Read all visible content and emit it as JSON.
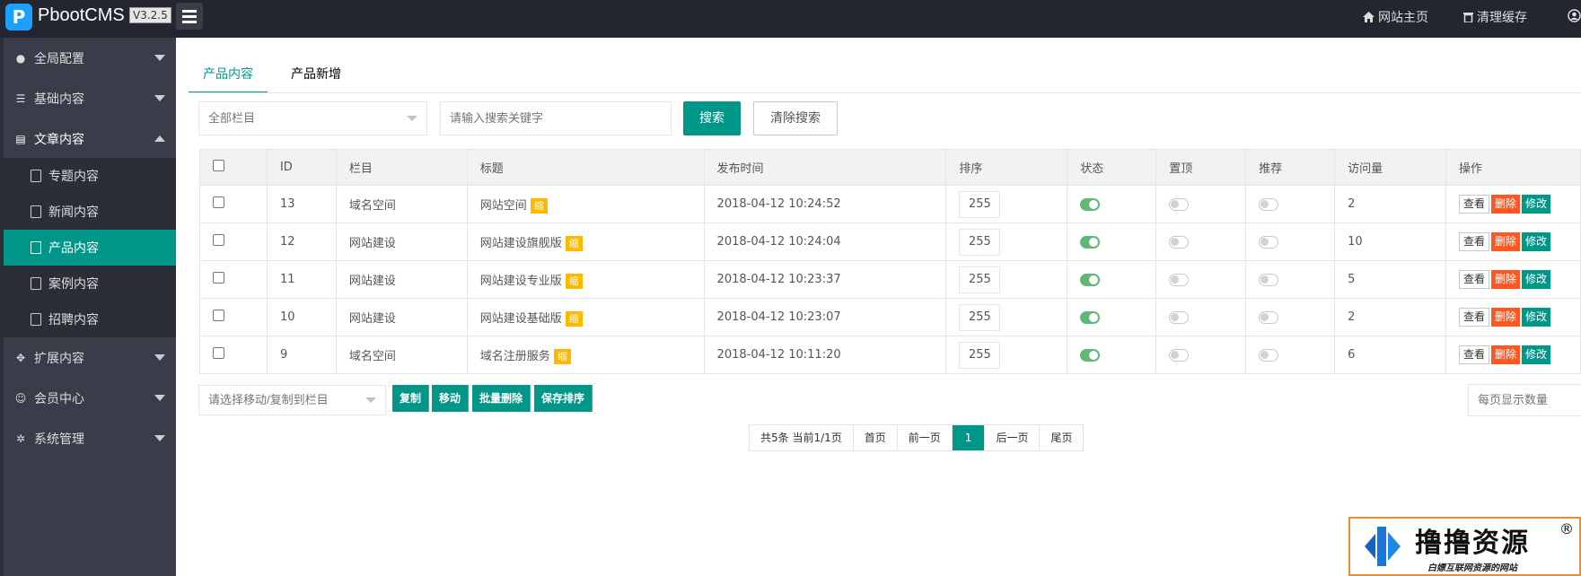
{
  "header": {
    "brand": "PbootCMS",
    "version": "V3.2.5",
    "links": [
      {
        "label": "网站主页",
        "icon": "home-icon"
      },
      {
        "label": "清理缓存",
        "icon": "trash-icon"
      }
    ]
  },
  "sidebar": {
    "groups": [
      {
        "label": "全局配置",
        "icon": "globe-icon"
      },
      {
        "label": "基础内容",
        "icon": "sliders-icon"
      },
      {
        "label": "文章内容",
        "icon": "document-icon",
        "expanded": true
      },
      {
        "label": "扩展内容",
        "icon": "expand-icon"
      },
      {
        "label": "会员中心",
        "icon": "user-icon"
      },
      {
        "label": "系统管理",
        "icon": "gear-icon"
      }
    ],
    "sub_items": [
      {
        "label": "专题内容"
      },
      {
        "label": "新闻内容"
      },
      {
        "label": "产品内容",
        "active": true
      },
      {
        "label": "案例内容"
      },
      {
        "label": "招聘内容"
      }
    ]
  },
  "tabs": [
    {
      "label": "产品内容",
      "active": true
    },
    {
      "label": "产品新增"
    }
  ],
  "filter": {
    "category_select": "全部栏目",
    "search_placeholder": "请输入搜索关键字",
    "search_button": "搜索",
    "clear_button": "清除搜索"
  },
  "table": {
    "columns": [
      "ID",
      "栏目",
      "标题",
      "发布时间",
      "排序",
      "状态",
      "置顶",
      "推荐",
      "访问量",
      "操作"
    ],
    "badge_label": "缩",
    "action_labels": {
      "view": "查看",
      "delete": "删除",
      "edit": "修改"
    },
    "rows": [
      {
        "id": "13",
        "category": "域名空间",
        "title": "网站空间",
        "date": "2018-04-12 10:24:52",
        "sort": "255",
        "status": true,
        "top": false,
        "recommend": false,
        "views": "2"
      },
      {
        "id": "12",
        "category": "网站建设",
        "title": "网站建设旗舰版",
        "date": "2018-04-12 10:24:04",
        "sort": "255",
        "status": true,
        "top": false,
        "recommend": false,
        "views": "10"
      },
      {
        "id": "11",
        "category": "网站建设",
        "title": "网站建设专业版",
        "date": "2018-04-12 10:23:37",
        "sort": "255",
        "status": true,
        "top": false,
        "recommend": false,
        "views": "5"
      },
      {
        "id": "10",
        "category": "网站建设",
        "title": "网站建设基础版",
        "date": "2018-04-12 10:23:07",
        "sort": "255",
        "status": true,
        "top": false,
        "recommend": false,
        "views": "2"
      },
      {
        "id": "9",
        "category": "域名空间",
        "title": "域名注册服务",
        "date": "2018-04-12 10:11:20",
        "sort": "255",
        "status": true,
        "top": false,
        "recommend": false,
        "views": "6"
      }
    ]
  },
  "bulk": {
    "move_select": "请选择移动/复制到栏目",
    "buttons": [
      "复制",
      "移动",
      "批量删除",
      "保存排序"
    ],
    "per_page_select": "每页显示数量"
  },
  "pagination": {
    "summary": "共5条 当前1/1页",
    "first": "首页",
    "prev": "前一页",
    "current": "1",
    "next": "后一页",
    "last": "尾页"
  },
  "watermark": {
    "title": "撸撸资源",
    "subtitle": "白嫖互联网资源的网站",
    "mark": "®"
  },
  "colors": {
    "accent": "#009688",
    "danger": "#ff5722",
    "warning": "#ffb800",
    "toggle_on": "#5fb878",
    "topbar": "#23262e",
    "sidebar": "#393d49"
  }
}
